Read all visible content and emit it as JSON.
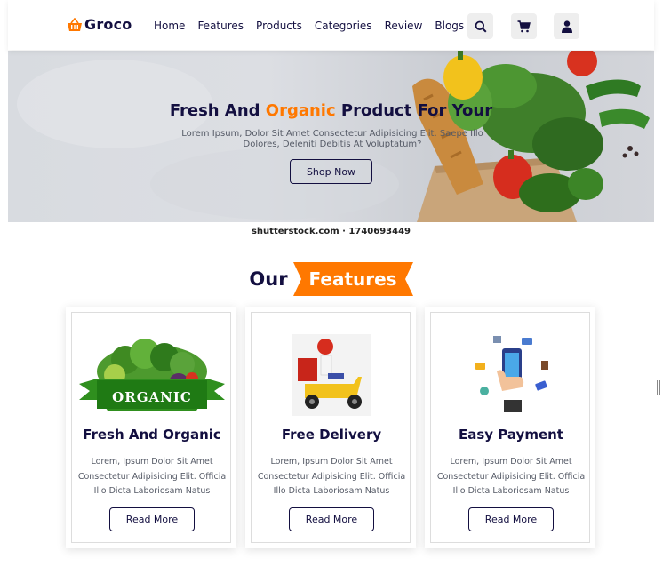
{
  "brand": {
    "name": "Groco",
    "accent_color": "#ff7800",
    "text_color": "#130f40"
  },
  "nav": {
    "items": [
      {
        "label": "Home"
      },
      {
        "label": "Features"
      },
      {
        "label": "Products"
      },
      {
        "label": "Categories"
      },
      {
        "label": "Review"
      },
      {
        "label": "Blogs"
      }
    ]
  },
  "header_icons": [
    "search-icon",
    "cart-icon",
    "user-icon"
  ],
  "hero": {
    "title_before": "Fresh And ",
    "title_accent": "Organic",
    "title_after": " Product For Your",
    "subtitle_line1": "Lorem Ipsum, Dolor Sit Amet Consectetur Adipisicing Elit. Saepe Illo",
    "subtitle_line2": "Dolores, Deleniti Debitis At Voluptatum?",
    "button": "Shop Now"
  },
  "watermark": "shutterstock.com · 1740693449",
  "features_heading": {
    "word1": "Our",
    "word2": "Features"
  },
  "cards": [
    {
      "title": "Fresh And Organic",
      "badge": "ORGANIC",
      "line1": "Lorem, Ipsum Dolor Sit Amet",
      "line2": "Consectetur Adipisicing Elit. Officia",
      "line3": "Illo Dicta Laboriosam Natus",
      "button": "Read More"
    },
    {
      "title": "Free Delivery",
      "line1": "Lorem, Ipsum Dolor Sit Amet",
      "line2": "Consectetur Adipisicing Elit. Officia",
      "line3": "Illo Dicta Laboriosam Natus",
      "button": "Read More"
    },
    {
      "title": "Easy Payment",
      "line1": "Lorem, Ipsum Dolor Sit Amet",
      "line2": "Consectetur Adipisicing Elit. Officia",
      "line3": "Illo Dicta Laboriosam Natus",
      "button": "Read More"
    }
  ]
}
